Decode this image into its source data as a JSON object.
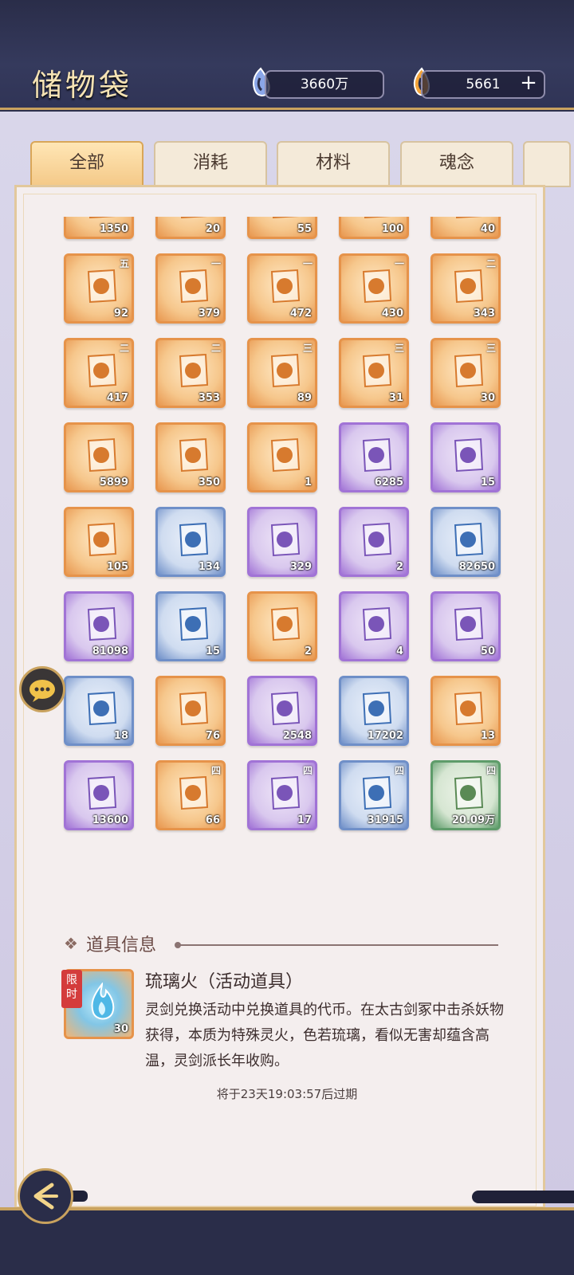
{
  "header": {
    "title": "储物袋",
    "currency_a": {
      "value": "3660万",
      "icon": "spirit-stone-icon"
    },
    "currency_b": {
      "value": "5661",
      "icon": "jade-icon"
    },
    "plus_label": "+"
  },
  "tabs": [
    {
      "label": "全部",
      "active": true
    },
    {
      "label": "消耗",
      "active": false
    },
    {
      "label": "材料",
      "active": false
    },
    {
      "label": "魂念",
      "active": false
    }
  ],
  "items": [
    {
      "count": "1350",
      "grade": "",
      "rarity": "orange",
      "icon": "book-icon"
    },
    {
      "count": "20",
      "grade": "",
      "rarity": "orange",
      "icon": "scroll-icon"
    },
    {
      "count": "55",
      "grade": "",
      "rarity": "orange",
      "icon": "scroll-icon"
    },
    {
      "count": "100",
      "grade": "",
      "rarity": "orange",
      "icon": "scroll-icon"
    },
    {
      "count": "40",
      "grade": "",
      "rarity": "orange",
      "icon": "scroll-icon"
    },
    {
      "count": "92",
      "grade": "五",
      "rarity": "orange",
      "icon": "talisman-icon"
    },
    {
      "count": "379",
      "grade": "一",
      "rarity": "orange",
      "icon": "scroll-icon"
    },
    {
      "count": "472",
      "grade": "一",
      "rarity": "orange",
      "icon": "scroll-icon"
    },
    {
      "count": "430",
      "grade": "一",
      "rarity": "orange",
      "icon": "scroll-icon"
    },
    {
      "count": "343",
      "grade": "二",
      "rarity": "orange",
      "icon": "scroll-icon"
    },
    {
      "count": "417",
      "grade": "二",
      "rarity": "orange",
      "icon": "scroll-icon"
    },
    {
      "count": "353",
      "grade": "二",
      "rarity": "orange",
      "icon": "scroll-icon"
    },
    {
      "count": "89",
      "grade": "三",
      "rarity": "orange",
      "icon": "scroll-icon"
    },
    {
      "count": "31",
      "grade": "三",
      "rarity": "orange",
      "icon": "scroll-icon"
    },
    {
      "count": "30",
      "grade": "三",
      "rarity": "orange",
      "icon": "scroll-icon"
    },
    {
      "count": "5899",
      "grade": "",
      "rarity": "orange",
      "icon": "scroll-roll-icon"
    },
    {
      "count": "350",
      "grade": "",
      "rarity": "orange",
      "icon": "fruit-icon"
    },
    {
      "count": "1",
      "grade": "",
      "rarity": "orange",
      "icon": "ticket-icon"
    },
    {
      "count": "6285",
      "grade": "",
      "rarity": "purple",
      "icon": "stone-icon"
    },
    {
      "count": "15",
      "grade": "",
      "rarity": "purple",
      "icon": "orb-icon"
    },
    {
      "count": "105",
      "grade": "",
      "rarity": "orange",
      "icon": "fox-icon"
    },
    {
      "count": "134",
      "grade": "",
      "rarity": "blue",
      "icon": "water-orb-icon"
    },
    {
      "count": "329",
      "grade": "",
      "rarity": "purple",
      "icon": "sword-icon"
    },
    {
      "count": "2",
      "grade": "",
      "rarity": "purple",
      "icon": "banner-icon"
    },
    {
      "count": "82650",
      "grade": "",
      "rarity": "blue",
      "icon": "crystal-icon"
    },
    {
      "count": "81098",
      "grade": "",
      "rarity": "purple",
      "icon": "crystal-icon"
    },
    {
      "count": "15",
      "grade": "",
      "rarity": "blue",
      "icon": "ice-crystal-icon"
    },
    {
      "count": "2",
      "grade": "",
      "rarity": "orange",
      "icon": "lantern-icon"
    },
    {
      "count": "4",
      "grade": "",
      "rarity": "purple",
      "icon": "gem-icon"
    },
    {
      "count": "50",
      "grade": "",
      "rarity": "purple",
      "icon": "gem-cluster-icon"
    },
    {
      "count": "18",
      "grade": "",
      "rarity": "blue",
      "icon": "egg-icon"
    },
    {
      "count": "76",
      "grade": "",
      "rarity": "orange",
      "icon": "eclipse-icon"
    },
    {
      "count": "2548",
      "grade": "",
      "rarity": "purple",
      "icon": "swirl-icon"
    },
    {
      "count": "17202",
      "grade": "",
      "rarity": "blue",
      "icon": "ore-icon"
    },
    {
      "count": "13",
      "grade": "",
      "rarity": "orange",
      "icon": "bone-icon"
    },
    {
      "count": "13600",
      "grade": "",
      "rarity": "purple",
      "icon": "herb-icon"
    },
    {
      "count": "66",
      "grade": "四",
      "rarity": "orange",
      "icon": "vine-icon"
    },
    {
      "count": "17",
      "grade": "四",
      "rarity": "purple",
      "icon": "berry-icon"
    },
    {
      "count": "31915",
      "grade": "四",
      "rarity": "blue",
      "icon": "flower-icon"
    },
    {
      "count": "20.09万",
      "grade": "四",
      "rarity": "green",
      "icon": "vase-icon"
    }
  ],
  "info": {
    "section_title": "道具信息",
    "selected": {
      "tag": "限时",
      "count": "30",
      "name": "琉璃火（活动道具）",
      "description": "灵剑兑换活动中兑换道具的代币。在太古剑冢中击杀妖物获得，本质为特殊灵火，色若琉璃，看似无害却蕴含高温，灵剑派长年收购。",
      "expire": "将于23天19:03:57后过期"
    }
  },
  "colors": {
    "header_bg": "#2a2d49",
    "gold": "#c9a25e",
    "orange_border": "#e6934a",
    "purple_border": "#a173d6",
    "blue_border": "#6f8fc8",
    "green_border": "#5e9c6a"
  }
}
